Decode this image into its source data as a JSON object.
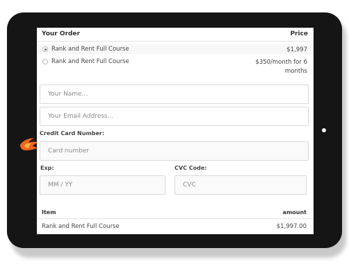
{
  "order": {
    "header_left": "Your Order",
    "header_right": "Price",
    "options": [
      {
        "label": "Rank and Rent Full Course",
        "price": "$1,997",
        "selected": true
      },
      {
        "label": "Rank and Rent Full Course",
        "price": "$350/month for 6 months",
        "selected": false
      }
    ]
  },
  "form": {
    "name_placeholder": "Your Name...",
    "email_placeholder": "Your Email Address...",
    "card_label": "Credit Card Number:",
    "card_placeholder": "Card number",
    "exp_label": "Exp:",
    "exp_placeholder": "MM / YY",
    "cvc_label": "CVC Code:",
    "cvc_placeholder": "CVC"
  },
  "summary": {
    "header_left": "Item",
    "header_right": "amount",
    "rows": [
      {
        "item": "Rank and Rent Full Course",
        "amount": "$1,997.00"
      }
    ]
  },
  "colors": {
    "tablet_body": "#151515",
    "logo_flame": "#f26522"
  },
  "icons": {
    "logo": "flame-logo-icon",
    "home": "home-button-dot"
  }
}
